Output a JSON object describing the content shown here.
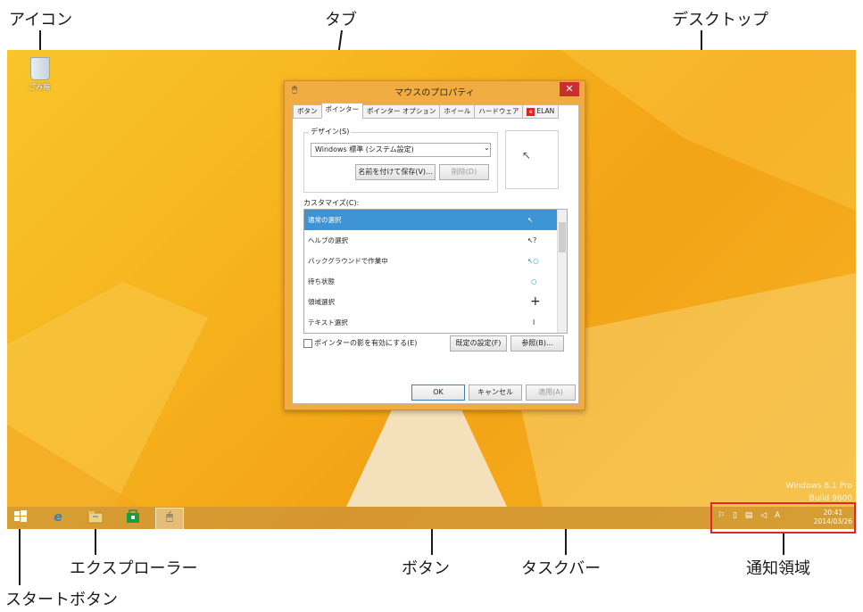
{
  "callouts": {
    "icon": "アイコン",
    "tab": "タブ",
    "desktop": "デスクトップ",
    "explorer": "エクスプローラー",
    "start": "スタートボタン",
    "button": "ボタン",
    "taskbar": "タスクバー",
    "notify": "通知領域"
  },
  "desktop": {
    "recycle_label": "ごみ箱",
    "watermark_line1": "Windows 8.1 Pro",
    "watermark_line2": "Build 9600"
  },
  "dialog": {
    "title": "マウスのプロパティ",
    "close": "✕",
    "tabs": [
      "ボタン",
      "ポインター",
      "ポインター オプション",
      "ホイール",
      "ハードウェア",
      "ELAN"
    ],
    "design_label": "デザイン(S)",
    "scheme": "Windows 標準 (システム設定)",
    "save_as": "名前を付けて保存(V)...",
    "delete": "削除(D)",
    "customize_label": "カスタマイズ(C):",
    "rows": [
      {
        "label": "通常の選択",
        "glyph": "↖"
      },
      {
        "label": "ヘルプの選択",
        "glyph": "↖?"
      },
      {
        "label": "バックグラウンドで作業中",
        "glyph": "↖○"
      },
      {
        "label": "待ち状態",
        "glyph": "○"
      },
      {
        "label": "領域選択",
        "glyph": "+"
      },
      {
        "label": "テキスト選択",
        "glyph": "I"
      }
    ],
    "shadow_checkbox": "ポインターの影を有効にする(E)",
    "use_default": "既定の設定(F)",
    "browse": "参照(B)...",
    "ok": "OK",
    "cancel": "キャンセル",
    "apply": "適用(A)"
  },
  "tray": {
    "time": "20:41",
    "date": "2014/03/26",
    "ime": "A"
  },
  "colors": {
    "accent_red": "#e0262d",
    "selection": "#3e93d5"
  }
}
